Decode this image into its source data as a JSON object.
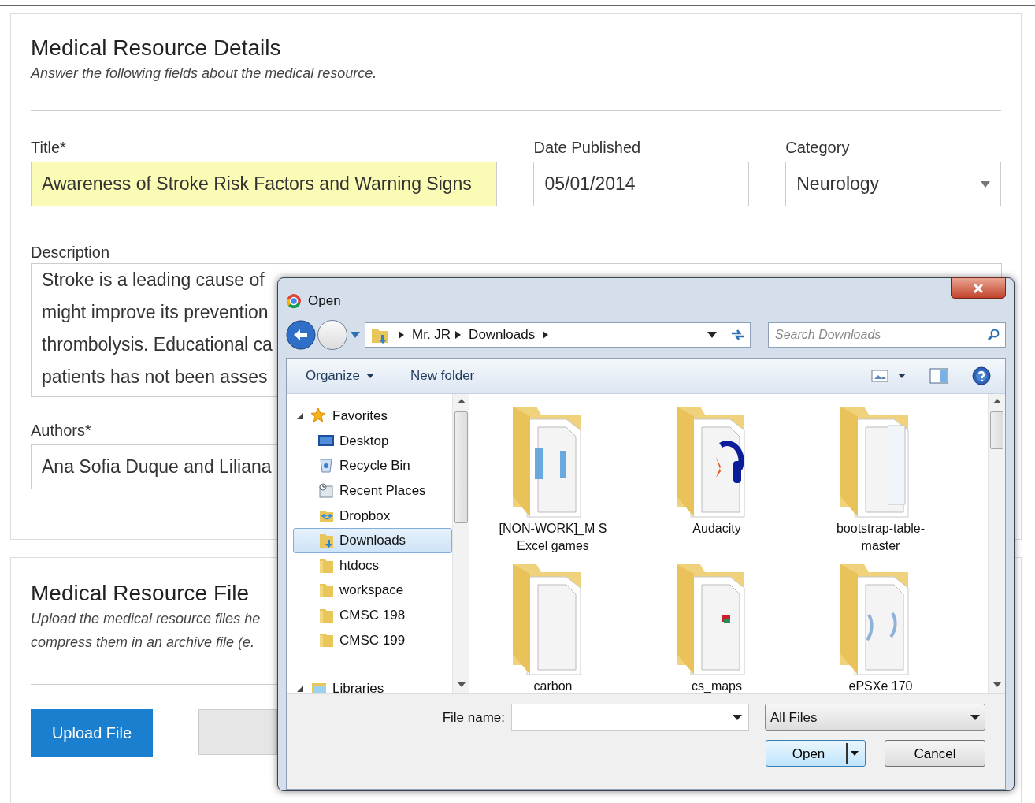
{
  "details": {
    "title": "Medical Resource Details",
    "subtitle": "Answer the following fields about the medical resource."
  },
  "title_field": {
    "label": "Title*",
    "value": "Awareness of Stroke Risk Factors and Warning Signs",
    "highlighted": true
  },
  "date_field": {
    "label": "Date Published",
    "value": "05/01/2014"
  },
  "category_field": {
    "label": "Category",
    "value": "Neurology"
  },
  "description": {
    "label": "Description",
    "lines": [
      "Stroke is a leading cause of",
      "might improve its prevention",
      "thrombolysis. Educational ca",
      "patients has not been asses"
    ]
  },
  "authors": {
    "label": "Authors*",
    "value": "Ana Sofia Duque and Liliana"
  },
  "file_section": {
    "title": "Medical Resource File",
    "subtitle_lines": [
      "Upload the medical resource files he",
      "compress them in an archive file (e."
    ]
  },
  "upload_button": "Upload File",
  "dialog": {
    "title": "Open",
    "breadcrumbs": [
      "Mr. JR",
      "Downloads"
    ],
    "search": {
      "placeholder": "Search Downloads"
    },
    "toolbar": {
      "organize": "Organize",
      "new_folder": "New folder"
    },
    "tree": [
      {
        "label": "Favorites",
        "kind": "favorites",
        "expanded": true,
        "children": [
          {
            "label": "Desktop",
            "kind": "desktop",
            "selected": false
          },
          {
            "label": "Recycle Bin",
            "kind": "recycle-bin",
            "selected": false
          },
          {
            "label": "Recent Places",
            "kind": "recent",
            "selected": false
          },
          {
            "label": "Dropbox",
            "kind": "dropbox",
            "selected": false
          },
          {
            "label": "Downloads",
            "kind": "downloads",
            "selected": true
          },
          {
            "label": "htdocs",
            "kind": "folder",
            "selected": false
          },
          {
            "label": "workspace",
            "kind": "folder",
            "selected": false
          },
          {
            "label": "CMSC 198",
            "kind": "folder",
            "selected": false
          },
          {
            "label": "CMSC 199",
            "kind": "folder",
            "selected": false
          }
        ]
      },
      {
        "label": "Libraries",
        "kind": "libraries",
        "expanded": true
      }
    ],
    "files": [
      {
        "name": "[NON-WORK]_M S Excel games",
        "kind": "documents"
      },
      {
        "name": "Audacity",
        "kind": "audio"
      },
      {
        "name": "bootstrap-table-master",
        "kind": "pages"
      },
      {
        "name": "carbon",
        "kind": "blank"
      },
      {
        "name": "cs_maps",
        "kind": "archive"
      },
      {
        "name": "ePSXe 170",
        "kind": "images"
      }
    ],
    "file_name": {
      "label": "File name:"
    },
    "file_type": "All Files",
    "buttons": [
      "Open",
      "Cancel"
    ]
  }
}
